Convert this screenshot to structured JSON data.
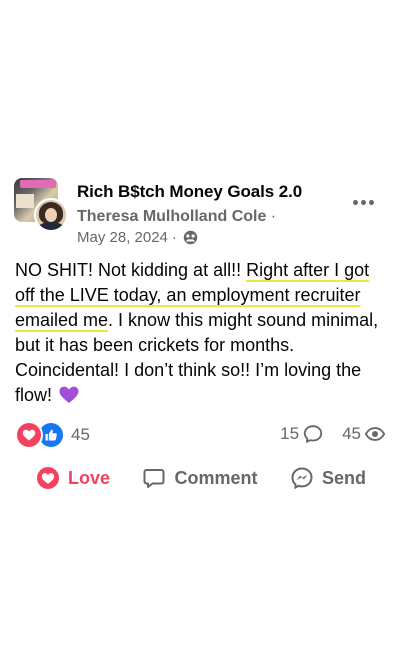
{
  "post": {
    "group_name": "Rich B$tch Money Goals 2.0",
    "author": "Theresa Mulholland Cole",
    "author_separator": " ·",
    "date": "May 28, 2024",
    "date_separator": " ·",
    "privacy_icon": "group-icon",
    "more_icon": "more-horizontal-icon",
    "text": {
      "part1": "NO SHIT! Not kidding at all!! ",
      "highlight": "Right after I got off the LIVE today, an employment recruiter emailed me",
      "part2": ". I know this might sound minimal, but it has been crickets for months. Coincidental! I don’t think so!! I’m loving the flow! ",
      "emoji": "purple-heart"
    }
  },
  "reactions": {
    "types": [
      "love",
      "like"
    ],
    "count": "45"
  },
  "stats": {
    "comments": "15",
    "views": "45"
  },
  "actions": {
    "love_label": "Love",
    "comment_label": "Comment",
    "send_label": "Send"
  },
  "colors": {
    "love": "#f3425f",
    "like": "#1877f2",
    "secondary_text": "#65676b",
    "highlight_underline": "#e8ea3c",
    "emoji_purple": "#a24ed9"
  }
}
